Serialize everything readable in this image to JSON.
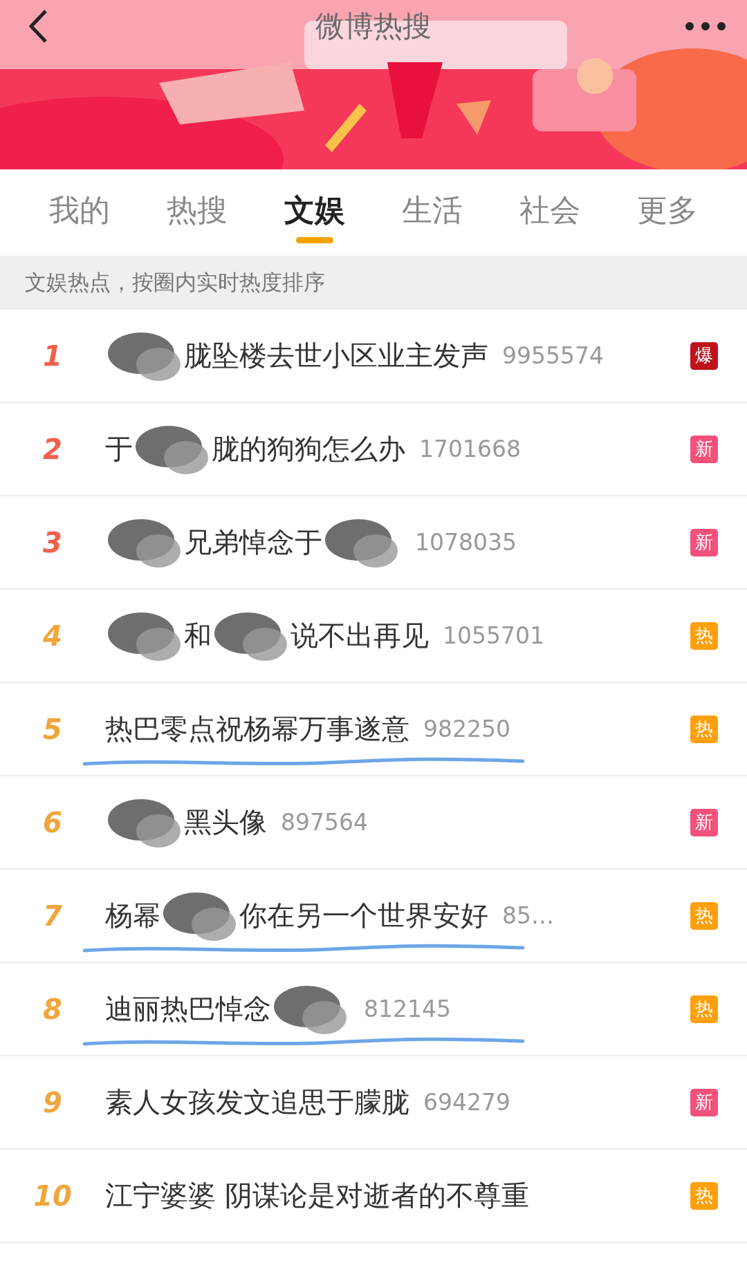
{
  "header": {
    "title": "微博热搜"
  },
  "tabs": [
    {
      "label": "我的",
      "selected": false
    },
    {
      "label": "热搜",
      "selected": false
    },
    {
      "label": "文娱",
      "selected": true
    },
    {
      "label": "生活",
      "selected": false
    },
    {
      "label": "社会",
      "selected": false
    },
    {
      "label": "更多",
      "selected": false
    }
  ],
  "notice": "文娱热点，按圈内实时热度排序",
  "rows": [
    {
      "rank": "1",
      "top": true,
      "parts": [
        {
          "kind": "scribble"
        },
        {
          "kind": "text",
          "text": "胧坠楼去世小区业主发声"
        }
      ],
      "count": "9955574",
      "badge": {
        "label": "爆",
        "color": "#c0121a"
      },
      "underlined": false
    },
    {
      "rank": "2",
      "top": true,
      "parts": [
        {
          "kind": "text",
          "text": "于"
        },
        {
          "kind": "scribble"
        },
        {
          "kind": "text",
          "text": "胧的狗狗怎么办"
        }
      ],
      "count": "1701668",
      "badge": {
        "label": "新",
        "color": "#f5517b"
      },
      "underlined": false
    },
    {
      "rank": "3",
      "top": true,
      "parts": [
        {
          "kind": "scribble"
        },
        {
          "kind": "text",
          "text": "兄弟悼念于"
        },
        {
          "kind": "scribble"
        }
      ],
      "count": "1078035",
      "badge": {
        "label": "新",
        "color": "#f5517b"
      },
      "underlined": false
    },
    {
      "rank": "4",
      "top": false,
      "parts": [
        {
          "kind": "scribble"
        },
        {
          "kind": "text",
          "text": "和"
        },
        {
          "kind": "scribble"
        },
        {
          "kind": "text",
          "text": "说不出再见"
        }
      ],
      "count": "1055701",
      "badge": {
        "label": "热",
        "color": "#ffa00c"
      },
      "underlined": false
    },
    {
      "rank": "5",
      "top": false,
      "parts": [
        {
          "kind": "text",
          "text": "热巴零点祝杨幂万事遂意"
        }
      ],
      "count": "982250",
      "badge": {
        "label": "热",
        "color": "#ffa00c"
      },
      "underlined": true
    },
    {
      "rank": "6",
      "top": false,
      "parts": [
        {
          "kind": "scribble"
        },
        {
          "kind": "text",
          "text": "黑头像"
        }
      ],
      "count": "897564",
      "badge": {
        "label": "新",
        "color": "#f5517b"
      },
      "underlined": false
    },
    {
      "rank": "7",
      "top": false,
      "parts": [
        {
          "kind": "text",
          "text": "杨幂"
        },
        {
          "kind": "scribble"
        },
        {
          "kind": "text",
          "text": "你在另一个世界安好"
        }
      ],
      "count": "85…",
      "badge": {
        "label": "热",
        "color": "#ffa00c"
      },
      "underlined": true
    },
    {
      "rank": "8",
      "top": false,
      "parts": [
        {
          "kind": "text",
          "text": "迪丽热巴悼念"
        },
        {
          "kind": "scribble"
        }
      ],
      "count": "812145",
      "badge": {
        "label": "热",
        "color": "#ffa00c"
      },
      "underlined": true
    },
    {
      "rank": "9",
      "top": false,
      "parts": [
        {
          "kind": "text",
          "text": "素人女孩发文追思于朦胧"
        }
      ],
      "count": "694279",
      "badge": {
        "label": "新",
        "color": "#f5517b"
      },
      "underlined": false
    },
    {
      "rank": "10",
      "top": false,
      "parts": [
        {
          "kind": "text",
          "text": "江宁婆婆 阴谋论是对逝者的不尊重"
        }
      ],
      "badge": {
        "label": "热",
        "color": "#ffa00c"
      },
      "underlined": false
    }
  ]
}
